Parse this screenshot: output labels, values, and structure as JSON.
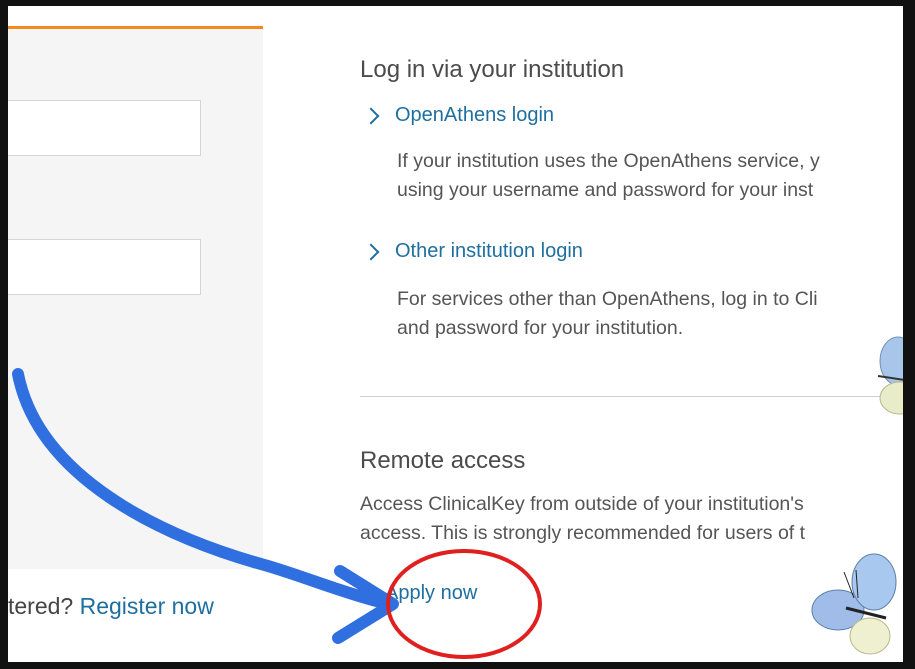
{
  "left_panel": {
    "register_prefix": "tered?",
    "register_link": "Register now"
  },
  "institution": {
    "heading": "Log in via your institution",
    "openathens": {
      "label": "OpenAthens login",
      "desc_line1": "If your institution uses the OpenAthens service, y",
      "desc_line2": "using your username and password for your inst"
    },
    "other": {
      "label": "Other institution login",
      "desc_line1": "For services other than OpenAthens, log in to Cli",
      "desc_line2": "and password for your institution."
    }
  },
  "remote": {
    "heading": "Remote access",
    "desc_line1": "Access ClinicalKey from outside of your institution's",
    "desc_line2": "access. This is strongly recommended for users of t",
    "apply_label": "Apply now"
  },
  "colors": {
    "link": "#1e6f9f",
    "accent_orange": "#f48a1f",
    "annotation_arrow": "#2f6fe0",
    "annotation_circle": "#e01f1f"
  },
  "icons": [
    "chevron-right-icon",
    "arrow-annotation",
    "circle-annotation",
    "butterfly-decoration"
  ]
}
